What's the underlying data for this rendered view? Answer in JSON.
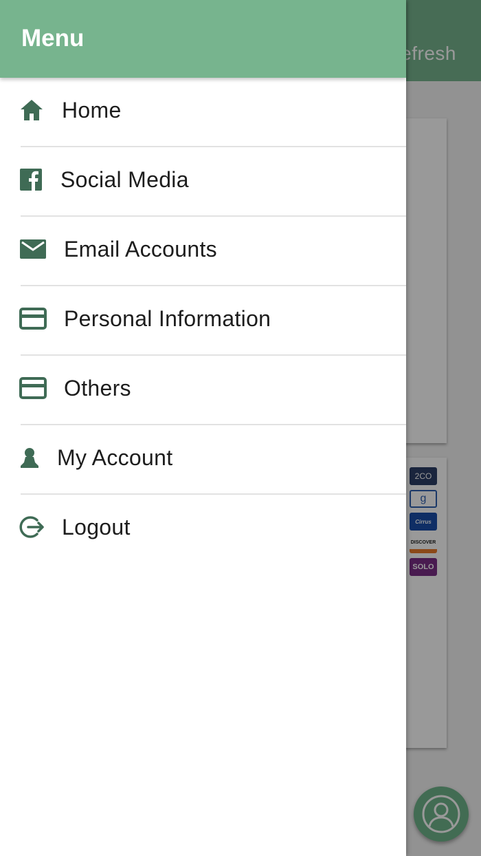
{
  "background": {
    "toolbar_action": "Refresh",
    "payment_logos": [
      "2CO",
      "g",
      "Cirrus",
      "DISCOVER",
      "SOLO"
    ]
  },
  "drawer": {
    "title": "Menu",
    "items": [
      {
        "label": "Home",
        "icon": "home-icon"
      },
      {
        "label": "Social Media",
        "icon": "facebook-icon"
      },
      {
        "label": "Email Accounts",
        "icon": "email-icon"
      },
      {
        "label": "Personal Information",
        "icon": "credit-card-icon"
      },
      {
        "label": "Others",
        "icon": "credit-card-icon"
      },
      {
        "label": "My Account",
        "icon": "person-icon"
      },
      {
        "label": "Logout",
        "icon": "logout-icon"
      }
    ]
  },
  "colors": {
    "primary": "#77b48e",
    "icon": "#3f6b55",
    "fab": "#6fb48a"
  }
}
